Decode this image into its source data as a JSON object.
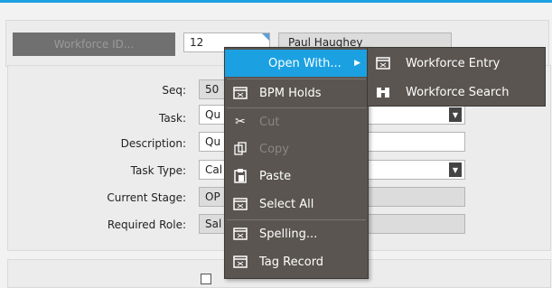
{
  "header": {
    "workforce_button_label": "Workforce ID...",
    "workforce_id_value": "12",
    "workforce_name_value": "Paul Haughey"
  },
  "form": {
    "seq_label": "Seq:",
    "seq_value": "50",
    "task_label": "Task:",
    "task_value": "Qu",
    "description_label": "Description:",
    "description_value": "Qu",
    "task_type_label": "Task Type:",
    "task_type_value": "Cal",
    "current_stage_label": "Current Stage:",
    "current_stage_value": "OP",
    "required_role_label": "Required Role:",
    "required_role_value": "Sal"
  },
  "context_menu": {
    "items": [
      {
        "label": "Open With...",
        "icon": "open-with",
        "state": "highlighted",
        "has_submenu": true
      },
      {
        "label": "BPM Holds",
        "icon": "window-icon",
        "state": "enabled"
      },
      {
        "label": "Cut",
        "icon": "scissors-icon",
        "state": "disabled"
      },
      {
        "label": "Copy",
        "icon": "copy-icon",
        "state": "disabled"
      },
      {
        "label": "Paste",
        "icon": "paste-icon",
        "state": "enabled"
      },
      {
        "label": "Select All",
        "icon": "window-icon",
        "state": "enabled"
      },
      {
        "label": "Spelling...",
        "icon": "window-icon",
        "state": "enabled"
      },
      {
        "label": "Tag Record",
        "icon": "window-icon",
        "state": "enabled"
      }
    ]
  },
  "submenu": {
    "items": [
      {
        "label": "Workforce Entry",
        "icon": "window-icon"
      },
      {
        "label": "Workforce Search",
        "icon": "binoculars-icon"
      }
    ]
  },
  "colors": {
    "accent": "#1ba1e2",
    "menu_bg": "#5a5550",
    "button_bg": "#707070"
  }
}
